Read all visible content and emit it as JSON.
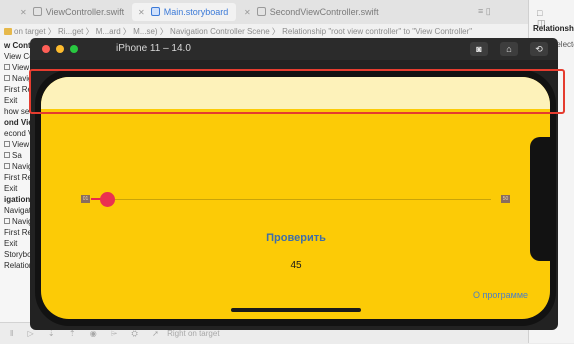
{
  "xcode": {
    "tabs": [
      {
        "label": "ViewController.swift",
        "active": false
      },
      {
        "label": "Main.storyboard",
        "active": true
      },
      {
        "label": "SecondViewController.swift",
        "active": false
      }
    ],
    "jumpbar": "on target 〉 Ri...get 〉 M...ard 〉 M...se) 〉 Navigation Controller Scene 〉 Relationship \"root view controller\" to \"View Controller\"",
    "outline": [
      {
        "text": "w Contr",
        "header": true
      },
      {
        "text": "View Controller",
        "header": false
      },
      {
        "text": "View",
        "header": false,
        "box": true
      },
      {
        "text": "Naviga",
        "header": false,
        "box": true
      },
      {
        "text": "First Res",
        "header": false
      },
      {
        "text": "Exit",
        "header": false
      },
      {
        "text": "how seg",
        "header": false
      },
      {
        "text": "ond Vie",
        "header": true
      },
      {
        "text": "econd V",
        "header": false
      },
      {
        "text": "View",
        "header": false,
        "box": true
      },
      {
        "text": "Sa",
        "header": false,
        "box": true
      },
      {
        "text": "Navig",
        "header": false,
        "box": true
      },
      {
        "text": "First Res",
        "header": false
      },
      {
        "text": "Exit",
        "header": false
      },
      {
        "text": "igation",
        "header": true
      },
      {
        "text": "Navigatio",
        "header": false
      },
      {
        "text": "Navig",
        "header": false,
        "box": true
      },
      {
        "text": "First Res",
        "header": false
      },
      {
        "text": "Exit",
        "header": false
      },
      {
        "text": "Storyboa",
        "header": false
      },
      {
        "text": "Relations",
        "header": false
      }
    ],
    "inspector": {
      "title": "Relationship",
      "sub": "Selecte"
    },
    "bottombar": "Right on target"
  },
  "simulator": {
    "title": "iPhone 11 – 14.0",
    "buttons": [
      "screenshot-icon",
      "home-icon",
      "rotate-icon"
    ],
    "colors": {
      "background": "#fccb06",
      "status_bar": "#fdf2ba",
      "slider_thumb": "#ea3150",
      "button_text": "#3e6ea8"
    }
  },
  "app": {
    "slider_min_label": "01",
    "slider_max_label": "50",
    "slider_value": 1,
    "slider_range": [
      1,
      50
    ],
    "check_button": "Проверить",
    "target_value": "45",
    "about_link": "О программе"
  }
}
